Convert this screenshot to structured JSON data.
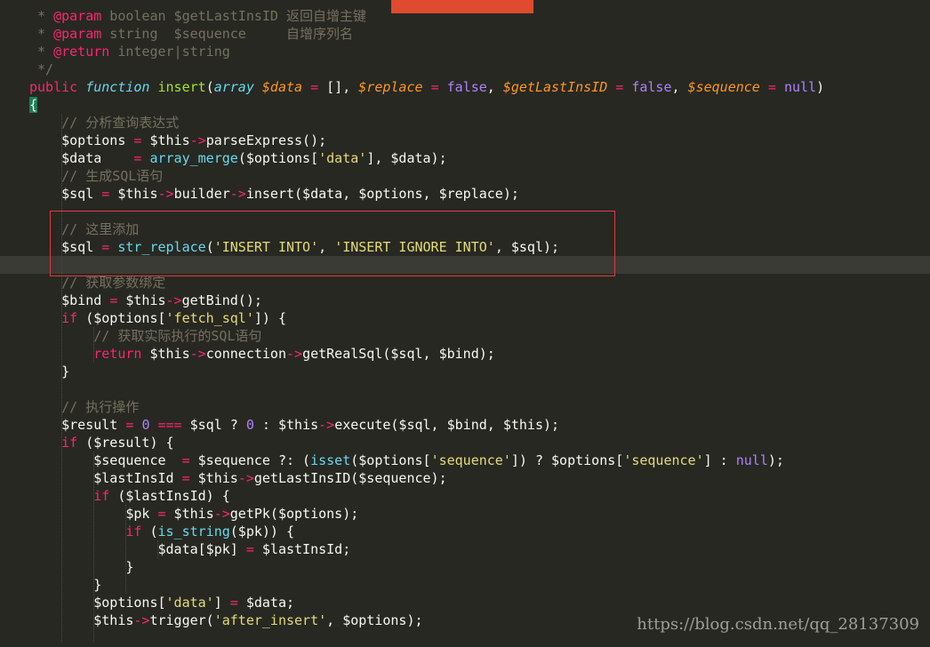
{
  "editor": {
    "lines": [
      {
        "tokens": [
          [
            "c",
            " * "
          ],
          [
            "k",
            "@param"
          ],
          [
            "c",
            " boolean $getLastInsID 返回自增主键"
          ]
        ]
      },
      {
        "tokens": [
          [
            "c",
            " * "
          ],
          [
            "k",
            "@param"
          ],
          [
            "c",
            " string  $sequence     自增序列名"
          ]
        ]
      },
      {
        "tokens": [
          [
            "c",
            " * "
          ],
          [
            "k",
            "@return"
          ],
          [
            "c",
            " integer|string"
          ]
        ]
      },
      {
        "tokens": [
          [
            "c",
            " */"
          ]
        ]
      },
      {
        "tokens": [
          [
            "k",
            "public"
          ],
          [
            "p",
            " "
          ],
          [
            "f",
            "function"
          ],
          [
            "p",
            " "
          ],
          [
            "g",
            "insert"
          ],
          [
            "p",
            "("
          ],
          [
            "f",
            "array"
          ],
          [
            "p",
            " "
          ],
          [
            "vi",
            "$data"
          ],
          [
            "p",
            " "
          ],
          [
            "o",
            "="
          ],
          [
            "p",
            " [], "
          ],
          [
            "vi",
            "$replace"
          ],
          [
            "p",
            " "
          ],
          [
            "o",
            "="
          ],
          [
            "p",
            " "
          ],
          [
            "n",
            "false"
          ],
          [
            "p",
            ", "
          ],
          [
            "vi",
            "$getLastInsID"
          ],
          [
            "p",
            " "
          ],
          [
            "o",
            "="
          ],
          [
            "p",
            " "
          ],
          [
            "n",
            "false"
          ],
          [
            "p",
            ", "
          ],
          [
            "vi",
            "$sequence"
          ],
          [
            "p",
            " "
          ],
          [
            "o",
            "="
          ],
          [
            "p",
            " "
          ],
          [
            "n",
            "null"
          ],
          [
            "p",
            ")"
          ]
        ]
      },
      {
        "tokens": [
          [
            "brace",
            "{"
          ]
        ]
      },
      {
        "tokens": [
          [
            "p",
            "    "
          ],
          [
            "c",
            "// 分析查询表达式"
          ]
        ]
      },
      {
        "tokens": [
          [
            "p",
            "    $options "
          ],
          [
            "o",
            "="
          ],
          [
            "p",
            " $this"
          ],
          [
            "o",
            "->"
          ],
          [
            "p",
            "parseExpress();"
          ]
        ]
      },
      {
        "tokens": [
          [
            "p",
            "    $data    "
          ],
          [
            "o",
            "="
          ],
          [
            "p",
            " "
          ],
          [
            "b",
            "array_merge"
          ],
          [
            "p",
            "($options["
          ],
          [
            "s",
            "'data'"
          ],
          [
            "p",
            "], $data);"
          ]
        ]
      },
      {
        "tokens": [
          [
            "p",
            "    "
          ],
          [
            "c",
            "// 生成SQL语句"
          ]
        ]
      },
      {
        "tokens": [
          [
            "p",
            "    $sql "
          ],
          [
            "o",
            "="
          ],
          [
            "p",
            " $this"
          ],
          [
            "o",
            "->"
          ],
          [
            "p",
            "builder"
          ],
          [
            "o",
            "->"
          ],
          [
            "p",
            "insert($data, $options, $replace);"
          ]
        ]
      },
      {
        "tokens": []
      },
      {
        "tokens": [
          [
            "p",
            "    "
          ],
          [
            "c",
            "// 这里添加"
          ]
        ]
      },
      {
        "tokens": [
          [
            "p",
            "    $sql "
          ],
          [
            "o",
            "="
          ],
          [
            "p",
            " "
          ],
          [
            "b",
            "str_replace"
          ],
          [
            "p",
            "("
          ],
          [
            "s",
            "'INSERT INTO'"
          ],
          [
            "p",
            ", "
          ],
          [
            "s",
            "'INSERT IGNORE INTO'"
          ],
          [
            "p",
            ", $sql);"
          ]
        ]
      },
      {
        "tokens": []
      },
      {
        "tokens": [
          [
            "p",
            "    "
          ],
          [
            "c",
            "// 获取参数绑定"
          ]
        ]
      },
      {
        "tokens": [
          [
            "p",
            "    $bind "
          ],
          [
            "o",
            "="
          ],
          [
            "p",
            " $this"
          ],
          [
            "o",
            "->"
          ],
          [
            "p",
            "getBind();"
          ]
        ]
      },
      {
        "tokens": [
          [
            "p",
            "    "
          ],
          [
            "k",
            "if"
          ],
          [
            "p",
            " ($options["
          ],
          [
            "s",
            "'fetch_sql'"
          ],
          [
            "p",
            "]) {"
          ]
        ]
      },
      {
        "tokens": [
          [
            "p",
            "        "
          ],
          [
            "c",
            "// 获取实际执行的SQL语句"
          ]
        ]
      },
      {
        "tokens": [
          [
            "p",
            "        "
          ],
          [
            "k",
            "return"
          ],
          [
            "p",
            " $this"
          ],
          [
            "o",
            "->"
          ],
          [
            "p",
            "connection"
          ],
          [
            "o",
            "->"
          ],
          [
            "p",
            "getRealSql($sql, $bind);"
          ]
        ]
      },
      {
        "tokens": [
          [
            "p",
            "    }"
          ]
        ]
      },
      {
        "tokens": []
      },
      {
        "tokens": [
          [
            "p",
            "    "
          ],
          [
            "c",
            "// 执行操作"
          ]
        ]
      },
      {
        "tokens": [
          [
            "p",
            "    $result "
          ],
          [
            "o",
            "="
          ],
          [
            "p",
            " "
          ],
          [
            "n",
            "0"
          ],
          [
            "p",
            " "
          ],
          [
            "o",
            "==="
          ],
          [
            "p",
            " $sql ? "
          ],
          [
            "n",
            "0"
          ],
          [
            "p",
            " : $this"
          ],
          [
            "o",
            "->"
          ],
          [
            "p",
            "execute($sql, $bind, $this);"
          ]
        ]
      },
      {
        "tokens": [
          [
            "p",
            "    "
          ],
          [
            "k",
            "if"
          ],
          [
            "p",
            " ($result) {"
          ]
        ]
      },
      {
        "tokens": [
          [
            "p",
            "        $sequence  "
          ],
          [
            "o",
            "="
          ],
          [
            "p",
            " $sequence ?: ("
          ],
          [
            "b",
            "isset"
          ],
          [
            "p",
            "($options["
          ],
          [
            "s",
            "'sequence'"
          ],
          [
            "p",
            "]) ? $options["
          ],
          [
            "s",
            "'sequence'"
          ],
          [
            "p",
            "] : "
          ],
          [
            "n",
            "null"
          ],
          [
            "p",
            ");"
          ]
        ]
      },
      {
        "tokens": [
          [
            "p",
            "        $lastInsId "
          ],
          [
            "o",
            "="
          ],
          [
            "p",
            " $this"
          ],
          [
            "o",
            "->"
          ],
          [
            "p",
            "getLastInsID($sequence);"
          ]
        ]
      },
      {
        "tokens": [
          [
            "p",
            "        "
          ],
          [
            "k",
            "if"
          ],
          [
            "p",
            " ($lastInsId) {"
          ]
        ]
      },
      {
        "tokens": [
          [
            "p",
            "            $pk "
          ],
          [
            "o",
            "="
          ],
          [
            "p",
            " $this"
          ],
          [
            "o",
            "->"
          ],
          [
            "p",
            "getPk($options);"
          ]
        ]
      },
      {
        "tokens": [
          [
            "p",
            "            "
          ],
          [
            "k",
            "if"
          ],
          [
            "p",
            " ("
          ],
          [
            "b",
            "is_string"
          ],
          [
            "p",
            "($pk)) {"
          ]
        ]
      },
      {
        "tokens": [
          [
            "p",
            "                $data[$pk] "
          ],
          [
            "o",
            "="
          ],
          [
            "p",
            " $lastInsId;"
          ]
        ]
      },
      {
        "tokens": [
          [
            "p",
            "            }"
          ]
        ]
      },
      {
        "tokens": [
          [
            "p",
            "        }"
          ]
        ]
      },
      {
        "tokens": [
          [
            "p",
            "        $options["
          ],
          [
            "s",
            "'data'"
          ],
          [
            "p",
            "] "
          ],
          [
            "o",
            "="
          ],
          [
            "p",
            " $data;"
          ]
        ]
      },
      {
        "tokens": [
          [
            "p",
            "        $this"
          ],
          [
            "o",
            "->"
          ],
          [
            "p",
            "trigger("
          ],
          [
            "s",
            "'after_insert'"
          ],
          [
            "p",
            ", $options);"
          ]
        ]
      },
      {
        "tokens": []
      }
    ]
  },
  "watermark": "https://blog.csdn.net/qq_28137309",
  "colors": {
    "background": "#272822",
    "comment": "#75715e",
    "keyword": "#f92672",
    "string": "#e6db74",
    "number": "#ae81ff",
    "function_name": "#a6e22e",
    "builtin": "#66d9ef",
    "param_variable": "#fd971f",
    "highlight_box": "#e23b3b",
    "tab_accent": "#e04a2f"
  }
}
